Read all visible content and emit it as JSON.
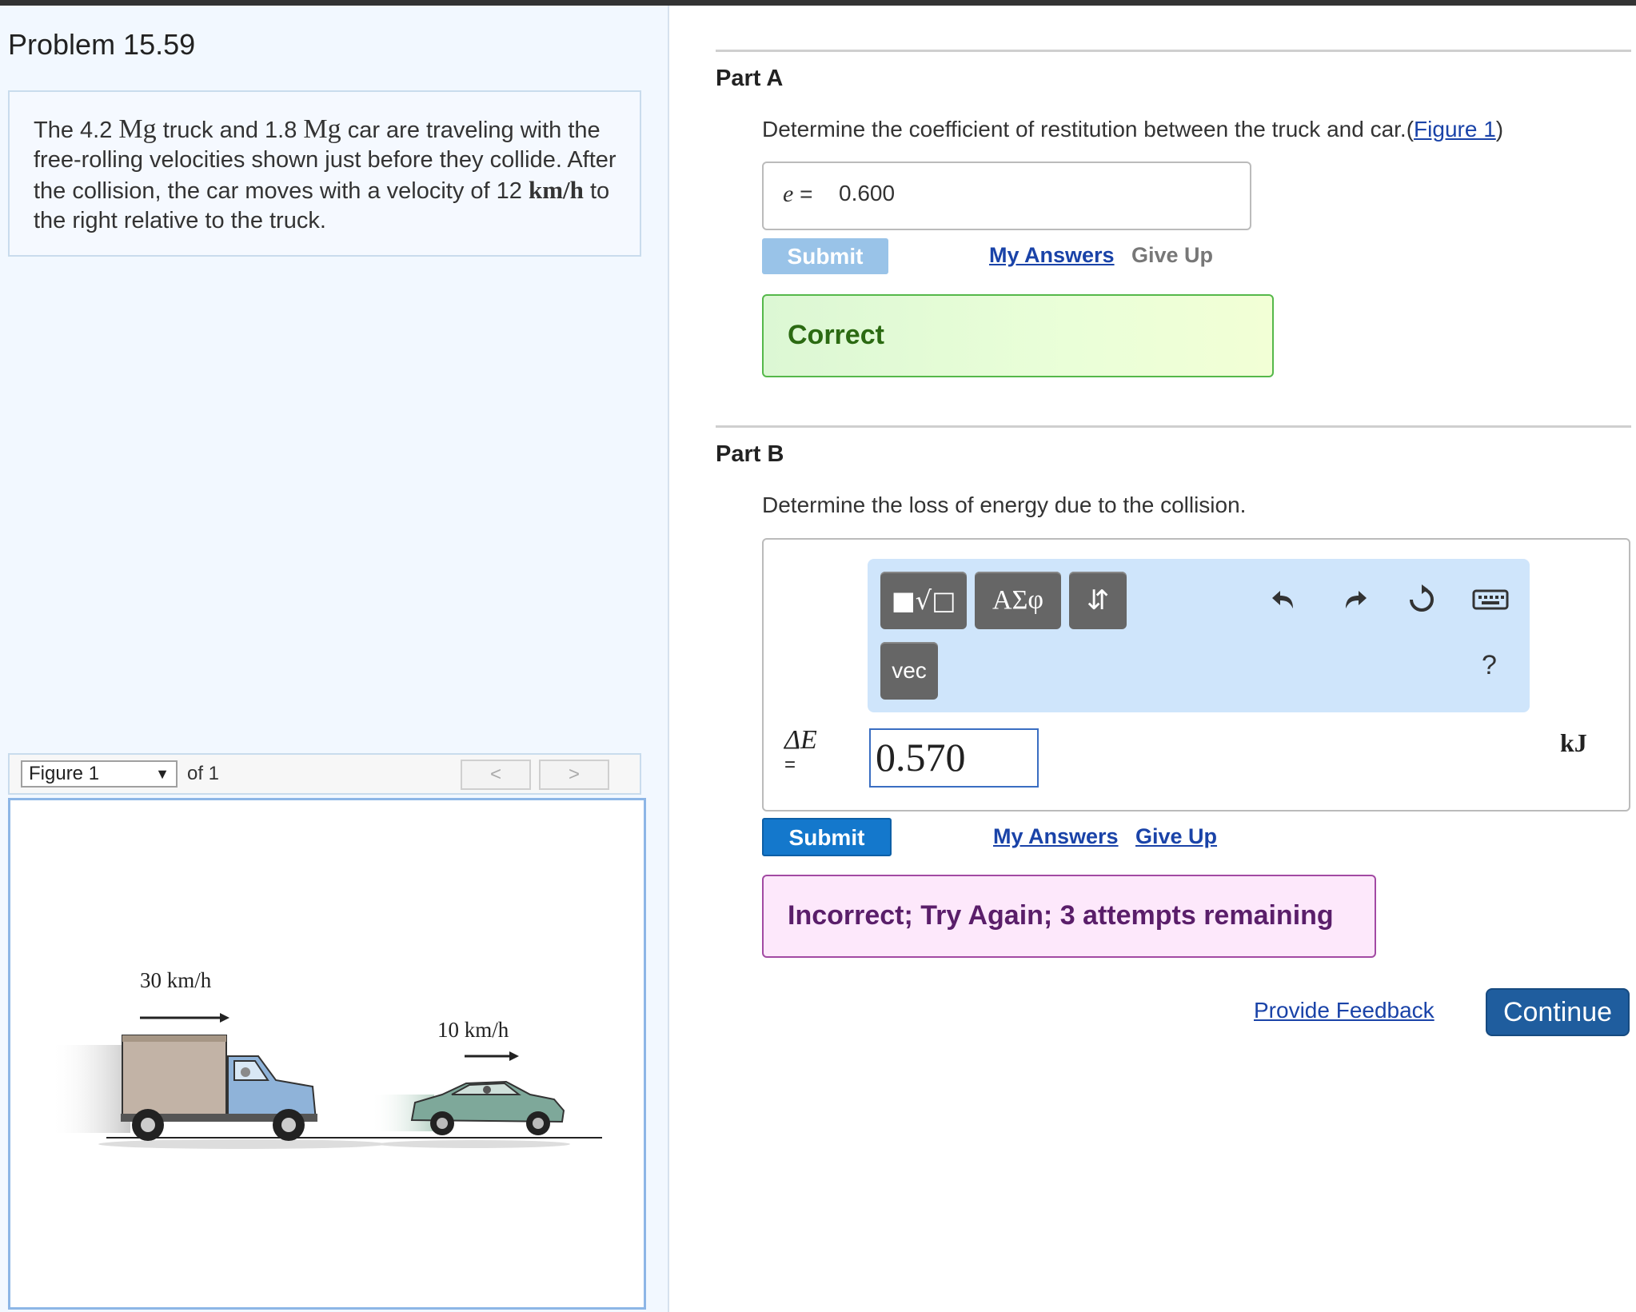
{
  "problem": {
    "title": "Problem 15.59",
    "text": {
      "p1": "The 4.2 ",
      "u1": "Mg",
      "p2": " truck and 1.8 ",
      "u2": "Mg",
      "p3": " car are traveling with the free-rolling velocities shown just before they collide. After the collision, the car moves with a velocity of 12 ",
      "u3": "km/h",
      "p4": " to the right relative to the truck."
    }
  },
  "figure_nav": {
    "selected": "Figure 1",
    "of_label": "of 1",
    "prev": "<",
    "next": ">"
  },
  "figure": {
    "truck_speed": "30 km/h",
    "car_speed": "10 km/h"
  },
  "partA": {
    "title": "Part A",
    "question": "Determine the coefficient of restitution between the truck and car.",
    "figure_link": "Figure 1",
    "paren_open": "(",
    "paren_close": ")",
    "answer_label": "e =",
    "answer_value": "0.600",
    "submit": "Submit",
    "my_answers": "My Answers",
    "give_up": "Give Up",
    "feedback": "Correct"
  },
  "partB": {
    "title": "Part B",
    "question": "Determine the loss of energy due to the collision.",
    "toolbar": {
      "templates_icon": "■√□",
      "symbols": "ΑΣφ",
      "arrows": "⇵",
      "vec": "vec",
      "help": "?"
    },
    "var_label": "ΔE",
    "eq": "=",
    "value": "0.570",
    "unit": "kJ",
    "submit": "Submit",
    "my_answers": "My Answers",
    "give_up": "Give Up",
    "feedback": "Incorrect; Try Again; 3 attempts remaining"
  },
  "footer": {
    "provide_feedback": "Provide Feedback",
    "continue": "Continue"
  },
  "colors": {
    "link": "#1a43a8",
    "submit_active": "#1478cc",
    "submit_disabled": "#99c3e8",
    "correct_border": "#55b84a",
    "incorrect_border": "#a24aa3",
    "continue": "#1f5d9e"
  }
}
